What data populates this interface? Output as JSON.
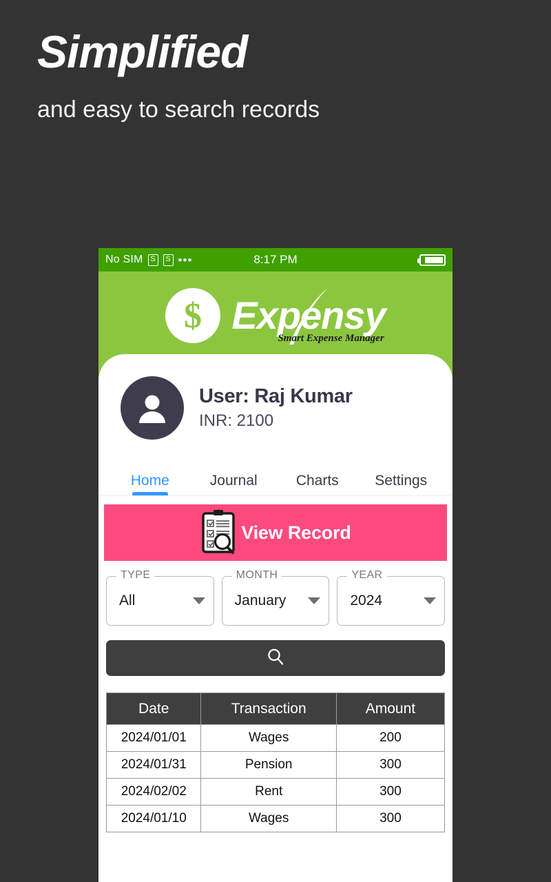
{
  "promo": {
    "headline": "Simplified",
    "subtitle": "and easy to search records"
  },
  "colors": {
    "background": "#333333",
    "brand_green": "#8CC63F",
    "statusbar_green": "#3FA000",
    "accent_pink": "#FC4A7F",
    "tab_active_blue": "#3399FF",
    "dark_control": "#3F3F3F"
  },
  "statusbar": {
    "carrier": "No SIM",
    "sim1_icon": "sim-card-icon",
    "sim2_icon": "sim-card-icon",
    "overflow": "•••",
    "time": "8:17 PM",
    "battery_icon": "battery-icon"
  },
  "brand": {
    "logo_icon": "dollar-coin-icon",
    "name": "Expensy",
    "tagline": "Smart Expense Manager"
  },
  "profile": {
    "avatar_icon": "user-avatar-icon",
    "name": "User: Raj Kumar",
    "balance": "INR: 2100"
  },
  "tabs": [
    {
      "label": "Home",
      "active": true
    },
    {
      "label": "Journal",
      "active": false
    },
    {
      "label": "Charts",
      "active": false
    },
    {
      "label": "Settings",
      "active": false
    }
  ],
  "view_record": {
    "icon": "clipboard-search-icon",
    "label": "View Record"
  },
  "filters": [
    {
      "label": "TYPE",
      "value": "All"
    },
    {
      "label": "MONTH",
      "value": "January"
    },
    {
      "label": "YEAR",
      "value": "2024"
    }
  ],
  "search": {
    "icon": "search-icon"
  },
  "table": {
    "headers": [
      "Date",
      "Transaction",
      "Amount"
    ],
    "rows": [
      [
        "2024/01/01",
        "Wages",
        "200"
      ],
      [
        "2024/01/31",
        "Pension",
        "300"
      ],
      [
        "2024/02/02",
        "Rent",
        "300"
      ],
      [
        "2024/01/10",
        "Wages",
        "300"
      ]
    ]
  }
}
